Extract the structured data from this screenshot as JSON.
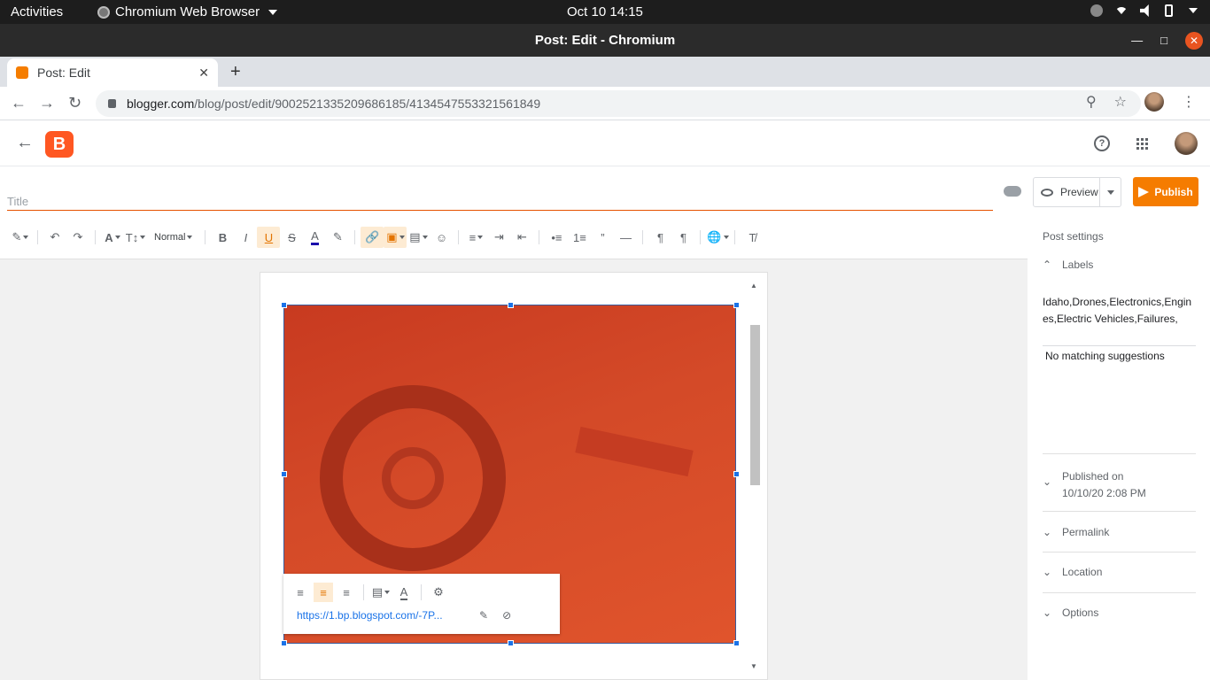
{
  "os": {
    "activities": "Activities",
    "app_name": "Chromium Web Browser",
    "clock": "Oct 10  14:15"
  },
  "window": {
    "title": "Post: Edit - Chromium"
  },
  "browser": {
    "tab_title": "Post: Edit",
    "url_domain": "blogger.com",
    "url_path": "/blog/post/edit/9002521335209686185/4134547553321561849"
  },
  "editor": {
    "title_placeholder": "Title",
    "preview_label": "Preview",
    "publish_label": "Publish",
    "paragraph_style": "Normal",
    "image_link": "https://1.bp.blogspot.com/-7P..."
  },
  "settings": {
    "heading": "Post settings",
    "labels_heading": "Labels",
    "labels_value": "Idaho,Drones,Electronics,Engines,Electric Vehicles,Failures,",
    "no_suggestions": "No matching suggestions",
    "published_heading": "Published on",
    "published_value": "10/10/20 2:08 PM",
    "permalink": "Permalink",
    "location": "Location",
    "options": "Options"
  },
  "colors": {
    "accent": "#f57c00",
    "brand": "#ff5722",
    "titlebar": "#2b2b2b"
  }
}
